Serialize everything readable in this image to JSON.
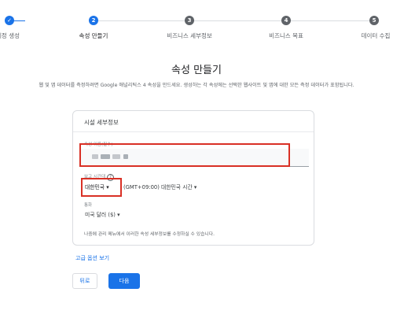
{
  "stepper": {
    "steps": [
      {
        "number": "",
        "label": "계정 생성",
        "state": "done"
      },
      {
        "number": "2",
        "label": "속성 만들기",
        "state": "active"
      },
      {
        "number": "3",
        "label": "비즈니스 세부정보",
        "state": "pending"
      },
      {
        "number": "4",
        "label": "비즈니스 목표",
        "state": "pending"
      },
      {
        "number": "5",
        "label": "데이터 수집",
        "state": "pending"
      }
    ]
  },
  "page": {
    "title": "속성 만들기",
    "description": "웹 및 앱 데이터를 측정하려면 Google 애널리틱스 4 속성을 만드세요. 생성하는 각 속성에는 선택한 웹사이트 및 앱에 대한 모든 측정 데이터가 포함됩니다."
  },
  "card": {
    "title": "시설 세부정보",
    "property_name_label": "속성 이름(필수)",
    "timezone_label": "보고 시간대",
    "timezone_country": "대한민국",
    "timezone_value": "(GMT+09:00) 대한민국 시간",
    "currency_label": "통화",
    "currency_value": "미국 달러 ($)",
    "note": "나중에 관리 메뉴에서 이러한 속성 세부정보를 수정하실 수 있습니다."
  },
  "links": {
    "advanced": "고급 옵션 보기"
  },
  "buttons": {
    "back": "뒤로",
    "next": "다음"
  },
  "colors": {
    "accent": "#1a73e8",
    "highlight": "#d93025",
    "inactive_step": "#5f6368"
  }
}
